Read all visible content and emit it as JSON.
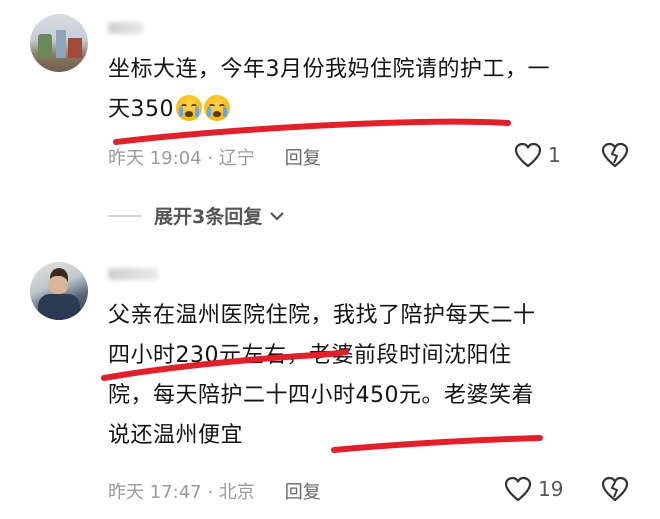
{
  "comments": [
    {
      "text_line1": "坐标大连，今年3月份我妈住院请的护工，一",
      "text_line2": "天350",
      "time": "昨天 19:04 · 辽宁",
      "reply_label": "回复",
      "likes": "1",
      "emoji": "loudly-crying-face"
    },
    {
      "text_line1": "父亲在温州医院住院，我找了陪护每天二十",
      "text_line2": "四小时230元左右，老婆前段时间沈阳住",
      "text_line3": "院，每天陪护二十四小时450元。老婆笑着",
      "text_line4": "说还温州便宜",
      "time": "昨天 17:47 · 北京",
      "reply_label": "回复",
      "likes": "19"
    }
  ],
  "expand_replies": {
    "label": "展开3条回复"
  },
  "colors": {
    "underline": "#e0202a",
    "meta": "#9a9a9a",
    "text": "#141414"
  }
}
